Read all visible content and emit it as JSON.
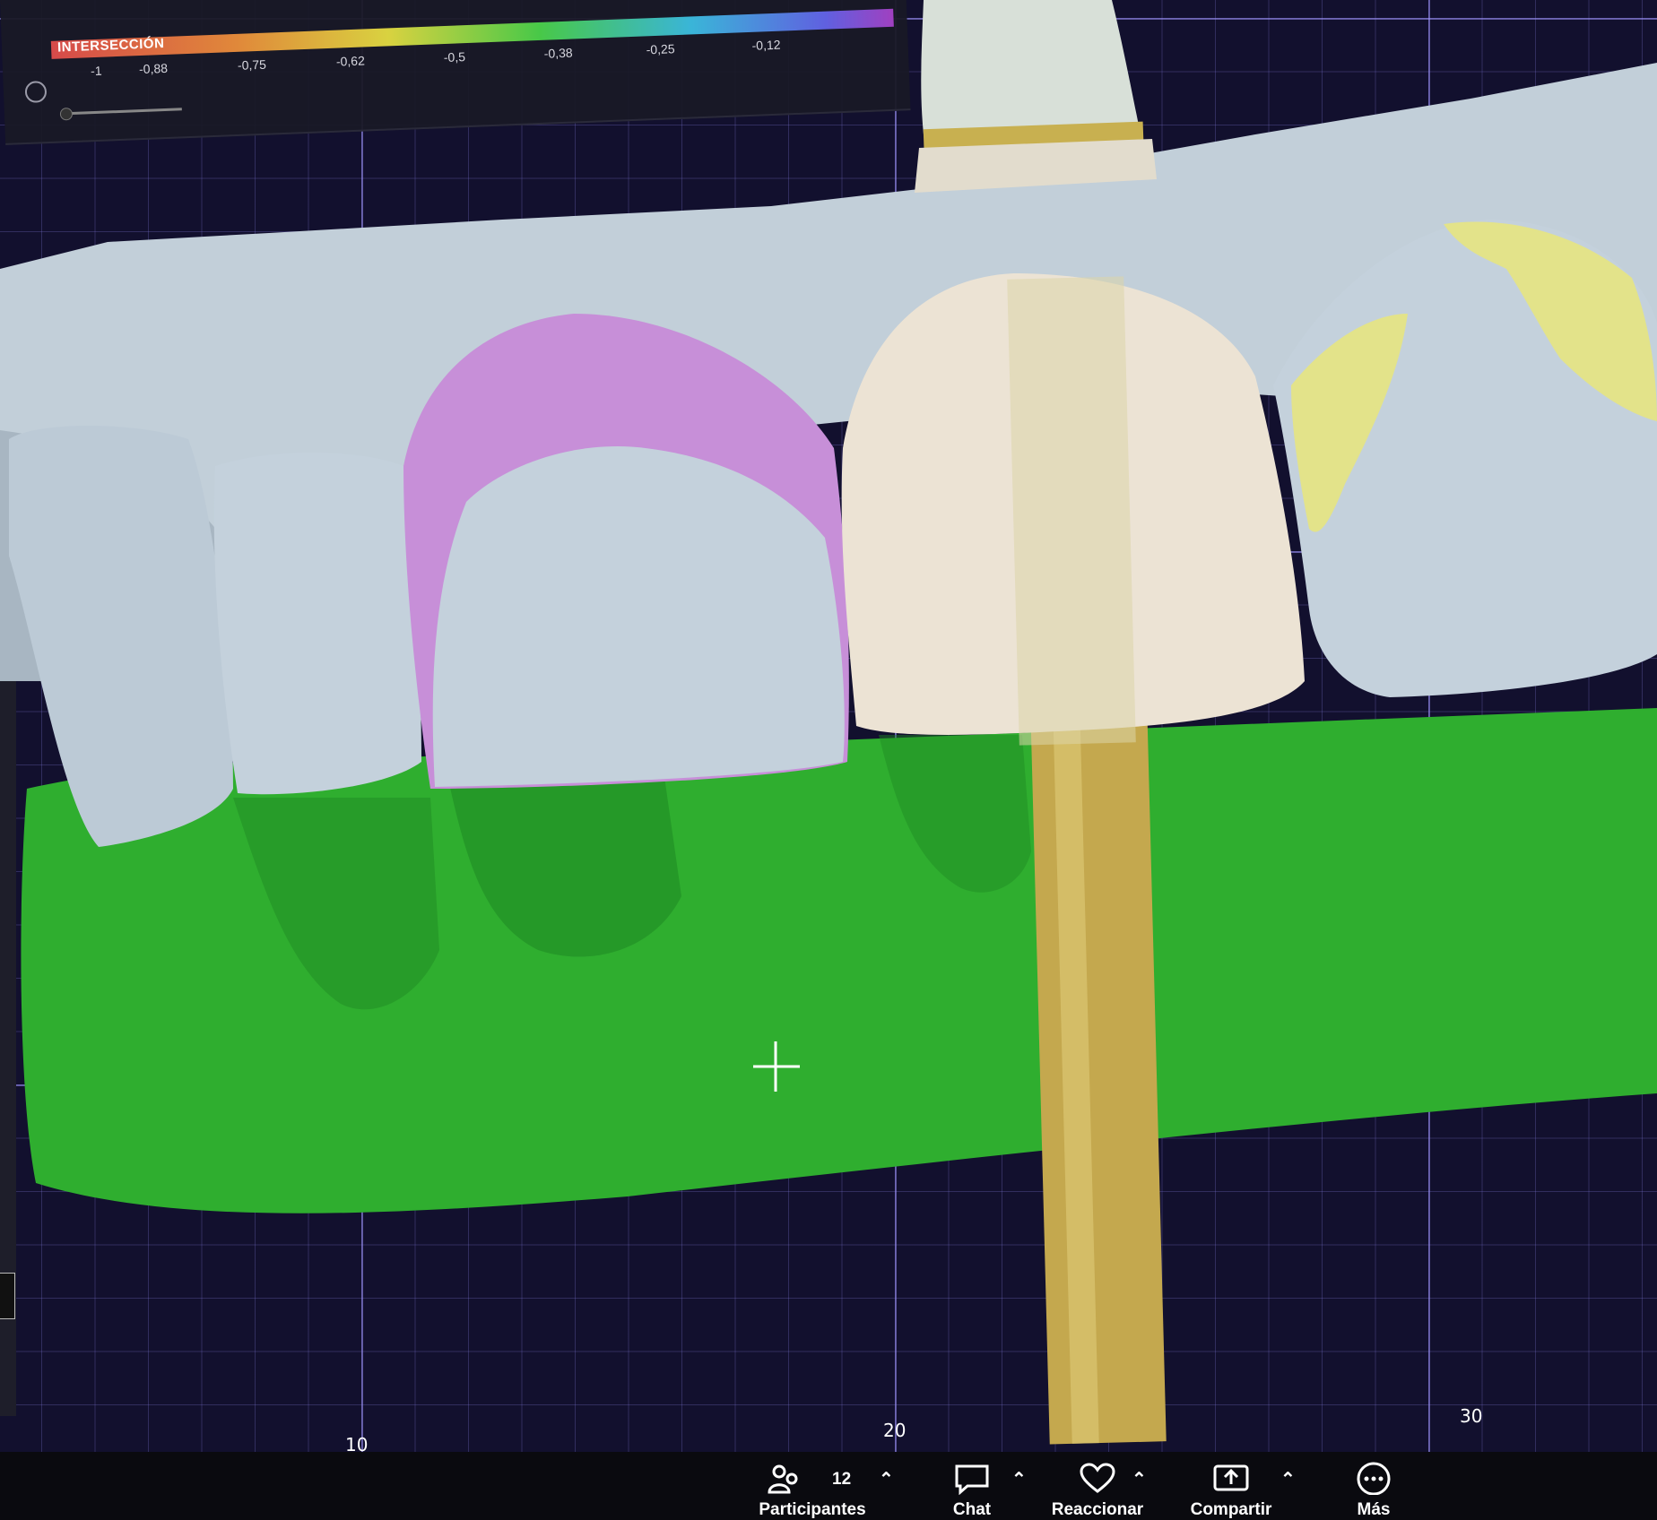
{
  "legend": {
    "title": "INTERSECCIÓN",
    "ticks": [
      "-1",
      "-0,88",
      "-0,75",
      "-0,62",
      "-0,5",
      "-0,38",
      "-0,25",
      "-0,12"
    ],
    "gauge_icon": "gauge-icon"
  },
  "axis": {
    "ticks": [
      "10",
      "20",
      "30"
    ]
  },
  "colors": {
    "gingiva_mesh": "#2fae2f",
    "model_gray": "#c2cfd9",
    "intersection_purple": "#c78fd8",
    "intersection_yellow": "#e3e38a",
    "abutment_gold": "#d4b85a",
    "crown_ivory": "#ece3d4",
    "grid_lines": "#a096ff"
  },
  "taskbar": {
    "participants": {
      "icon": "people-icon",
      "count": "12",
      "label": "Participantes"
    },
    "chat": {
      "icon": "chat-bubble-icon",
      "label": "Chat"
    },
    "react": {
      "icon": "heart-icon",
      "label": "Reaccionar"
    },
    "share": {
      "icon": "share-screen-icon",
      "label": "Compartir"
    },
    "more": {
      "icon": "more-dots-icon",
      "label": "Más"
    }
  }
}
